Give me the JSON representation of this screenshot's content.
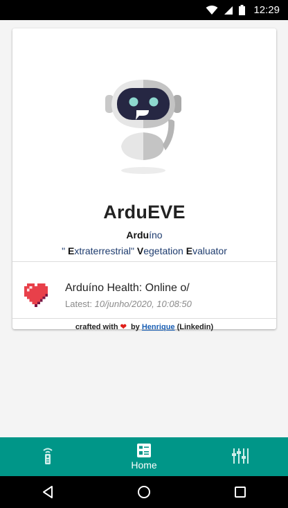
{
  "status_bar": {
    "time": "12:29",
    "icons": [
      "wifi-icon",
      "signal-icon",
      "battery-icon"
    ]
  },
  "card": {
    "title": "ArduEVE",
    "subtitle_line1": {
      "bold": "Ardu",
      "rest": "íno"
    },
    "subtitle_line2": {
      "q_open": "\" ",
      "e1": "E",
      "e1_rest": "xtraterrestrial\" ",
      "v": "V",
      "v_rest": "egetation ",
      "e2": "E",
      "e2_rest": "valuator"
    },
    "health": {
      "title": "Arduíno Health: Online o/",
      "latest_label": "Latest:",
      "latest_value": "10/junho/2020, 10:08:50"
    },
    "credit": {
      "prefix": "crafted with",
      "heart": "❤",
      "by": "by",
      "author": "Henrique",
      "suffix": "(Linkedin)"
    }
  },
  "bottom_nav": {
    "items": [
      {
        "icon": "remote-icon",
        "label": ""
      },
      {
        "icon": "dashboard-icon",
        "label": "Home"
      },
      {
        "icon": "sliders-icon",
        "label": ""
      }
    ]
  },
  "colors": {
    "accent": "#009688",
    "heart": "#e0201b",
    "link": "#1a5fb4"
  }
}
